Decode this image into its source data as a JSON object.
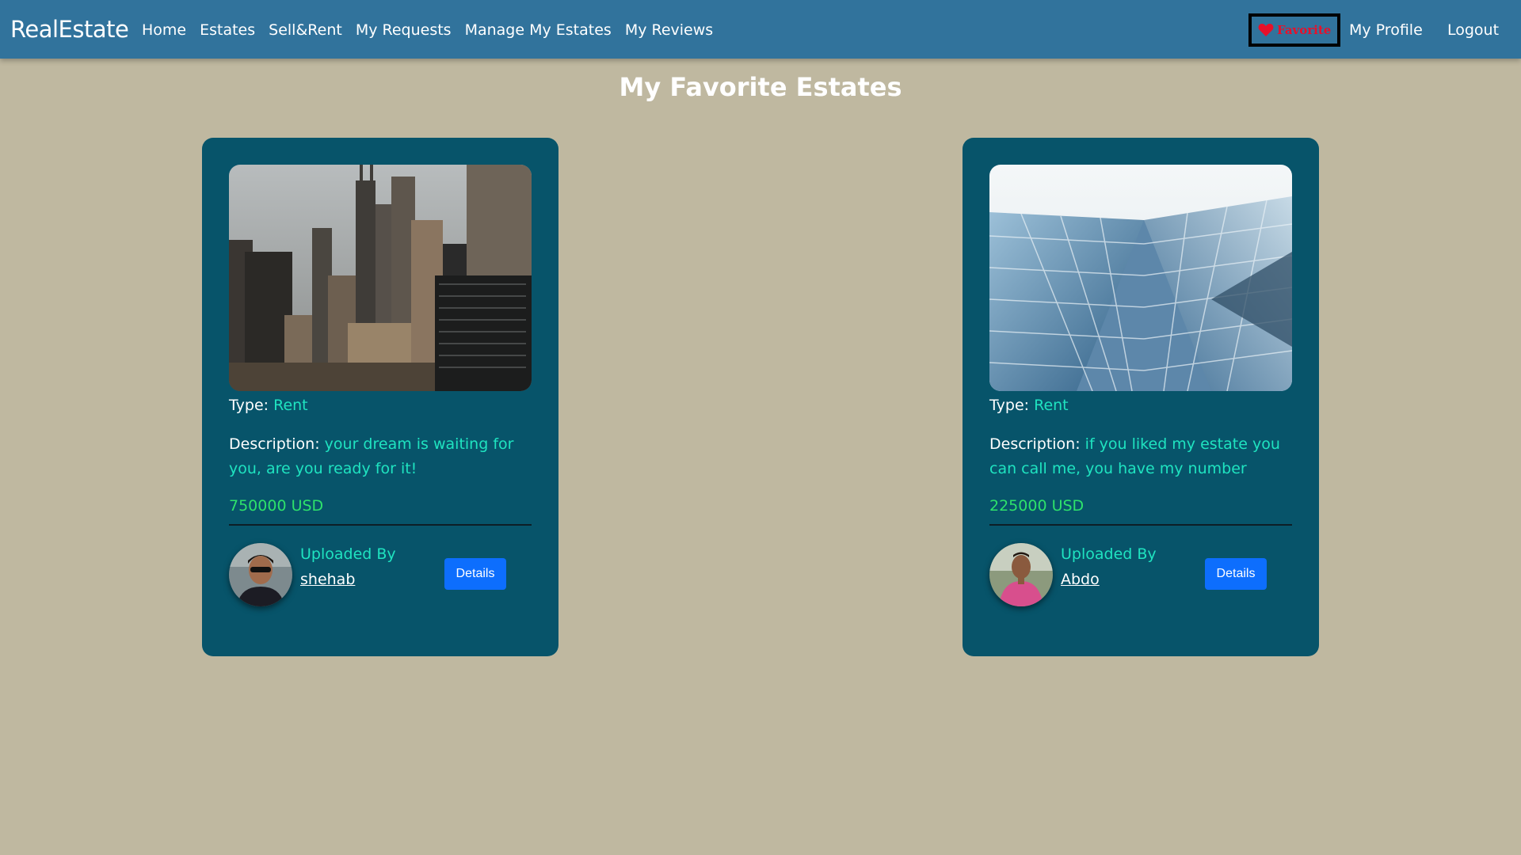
{
  "navbar": {
    "brand": "RealEstate",
    "links": [
      "Home",
      "Estates",
      "Sell&Rent",
      "My Requests",
      "Manage My Estates",
      "My Reviews"
    ],
    "favorite_label": "Favorite",
    "profile_label": "My Profile",
    "logout_label": "Logout",
    "favorite_icon": "heart-icon",
    "colors": {
      "bar": "#31739c",
      "favorite_text": "#e8102a"
    }
  },
  "page": {
    "title": "My Favorite Estates",
    "background": "#bfb8a0"
  },
  "estates": [
    {
      "image": "city-skyline-photo",
      "type_label": "Type:",
      "type_value": "Rent",
      "description_label": "Description:",
      "description_value": "your dream is waiting for you, are you ready for it!",
      "price": "750000 USD",
      "uploaded_by_label": "Uploaded By",
      "uploader": "shehab",
      "details_label": "Details"
    },
    {
      "image": "glass-tower-photo",
      "type_label": "Type:",
      "type_value": "Rent",
      "description_label": "Description:",
      "description_value": "if you liked my estate you can call me, you have my number",
      "price": "225000 USD",
      "uploaded_by_label": "Uploaded By",
      "uploader": "Abdo",
      "details_label": "Details"
    }
  ],
  "colors": {
    "card": "#07546a",
    "accent": "#1fe3c0",
    "price": "#2ee26b",
    "button": "#0d6efd"
  }
}
